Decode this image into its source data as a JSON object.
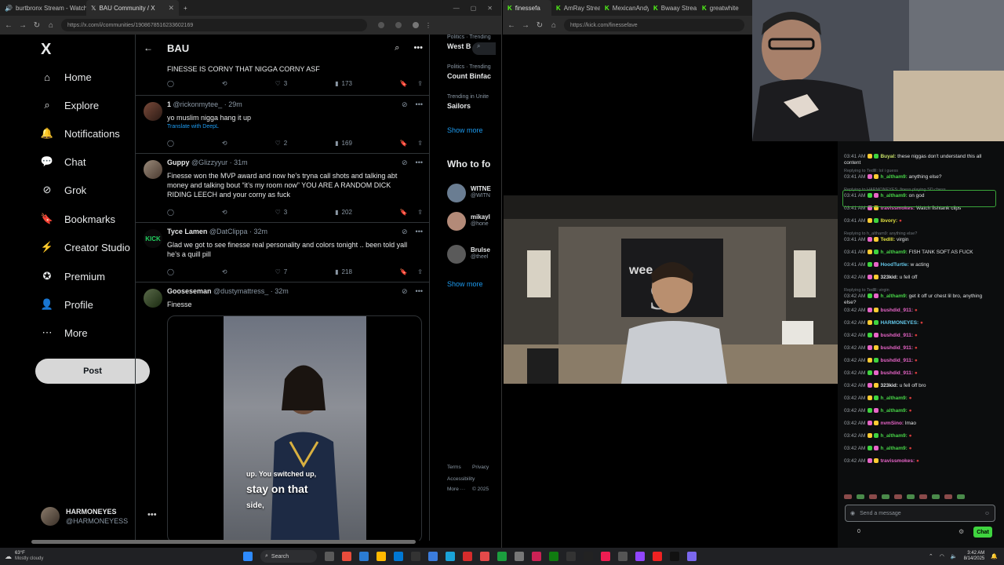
{
  "left_browser": {
    "tabs": [
      {
        "label": "burtbronx Stream - Watch Liv",
        "active": false
      },
      {
        "label": "BAU Community / X",
        "active": true
      }
    ],
    "new_tab": "+",
    "url": "https://x.com/i/communities/1908678516233602169"
  },
  "x_sidebar": {
    "logo": "X",
    "items": [
      {
        "label": "Home",
        "icon": "home-icon",
        "glyph": "⌂"
      },
      {
        "label": "Explore",
        "icon": "search-icon",
        "glyph": "⌕"
      },
      {
        "label": "Notifications",
        "icon": "bell-icon",
        "glyph": "🔔"
      },
      {
        "label": "Chat",
        "icon": "chat-icon",
        "glyph": "💬"
      },
      {
        "label": "Grok",
        "icon": "grok-icon",
        "glyph": "⊘"
      },
      {
        "label": "Bookmarks",
        "icon": "bookmark-icon",
        "glyph": "🔖"
      },
      {
        "label": "Creator Studio",
        "icon": "creator-studio-icon",
        "glyph": "⚡"
      },
      {
        "label": "Premium",
        "icon": "premium-icon",
        "glyph": "✪"
      },
      {
        "label": "Profile",
        "icon": "profile-icon",
        "glyph": "👤"
      },
      {
        "label": "More",
        "icon": "more-icon",
        "glyph": "⋯"
      }
    ],
    "post_label": "Post",
    "account_name": "HARMONEYES",
    "account_handle": "@HARMONEYESS"
  },
  "feed": {
    "title": "BAU",
    "prev_text": "FINESSE IS CORNY THAT NIGGA CORNY ASF",
    "prev_stats": {
      "likes": "3",
      "views": "173"
    },
    "tweets": [
      {
        "name": "1",
        "handle": "@rickonmytee_",
        "time": "29m",
        "text": "yo muslim nigga hang it up",
        "translate": "Translate with DeepL",
        "replies": "",
        "likes": "2",
        "views": "169"
      },
      {
        "name": "Guppy",
        "handle": "@Glizzyyur",
        "time": "31m",
        "text": "Finesse won the MVP award and now he’s tryna call shots and talking abt money and talking bout “it’s my room now” YOU ARE A RANDOM DICK RIDING LEECH and your corny as fuck",
        "likes": "3",
        "views": "202"
      },
      {
        "name": "Tyce Lamen",
        "handle": "@DatClippa",
        "time": "32m",
        "text": "Glad we got to see finesse real personality and colors tonight .. been told yall he’s a quill pill",
        "likes": "7",
        "views": "218"
      },
      {
        "name": "Gooseseman",
        "handle": "@dustymattress_",
        "time": "32m",
        "text": "Finesse"
      }
    ],
    "video_caption_1": "up. You switched up,",
    "video_caption_2": "stay on that",
    "video_caption_3": "side,"
  },
  "x_right": {
    "trend_1_cat": "Politics · Trending",
    "trend_1": "West B",
    "trend_2_cat": "Politics · Trending",
    "trend_2": "Count Binfac",
    "trend_3_cat": "Trending in Unite",
    "trend_3": "Sailors",
    "show_more": "Show more",
    "who_to_follow": "Who to fo",
    "follow": [
      {
        "name": "WITNE",
        "handle": "@WITN"
      },
      {
        "name": "mikayl",
        "handle": "@hone"
      },
      {
        "name": "Brulse",
        "handle": "@theel"
      }
    ],
    "show_more_2": "Show more",
    "footer_1": "Terms",
    "footer_2": "Privacy",
    "footer_3": "Accessibility",
    "footer_4": "More ···",
    "footer_5": "© 2025"
  },
  "right_browser": {
    "tabs": [
      "finessefa",
      "AmRay Strea",
      "MexicanAndy",
      "Bwaay Strea",
      "greatwhite"
    ],
    "url": "https://kick.com/finessefave"
  },
  "chat": {
    "messages": [
      {
        "time": "",
        "user": "",
        "text": "",
        "kind": "spacer"
      },
      {
        "time": "03:41 AM",
        "user": "Buyal:",
        "text": "these niggas don't understand this all content",
        "color": "#c9e36a"
      },
      {
        "kind": "reply",
        "text": "Replying to Tedlll: lol i guess"
      },
      {
        "time": "03:41 AM",
        "user": "h_altham9:",
        "text": "anything else?",
        "color": "#47d447"
      },
      {
        "kind": "reply",
        "text": "Replying to HARMONEYES: finess playing SD chess"
      },
      {
        "time": "03:41 AM",
        "user": "h_altham9:",
        "text": "on god",
        "color": "#47d447"
      },
      {
        "time": "03:41 AM",
        "user": "travissmokes:",
        "text": "Watch fishtank clips",
        "color": "#e865c8"
      },
      {
        "time": "03:41 AM",
        "user": "lbvory:",
        "text": "",
        "color": "#e0e040"
      },
      {
        "kind": "reply",
        "text": "Replying to h_altham9: anything else?"
      },
      {
        "time": "03:41 AM",
        "user": "Tedlll:",
        "text": "virgin",
        "color": "#e0e040"
      },
      {
        "time": "03:41 AM",
        "user": "h_altham9:",
        "text": "FISH TANK SOFT AS FUCK",
        "color": "#47d447"
      },
      {
        "time": "03:41 AM",
        "user": "HoodTurtle:",
        "text": "w acting",
        "color": "#63c6e8"
      },
      {
        "time": "03:42 AM",
        "user": "323kid:",
        "text": "u fell off",
        "color": "#dfe1e3"
      },
      {
        "kind": "reply",
        "text": "Replying to Tedlll: virgin"
      },
      {
        "time": "03:42 AM",
        "user": "h_altham9:",
        "text": "get it off ur chest lil bro, anything else?",
        "color": "#47d447"
      },
      {
        "time": "03:42 AM",
        "user": "bushdid_911:",
        "text": "",
        "color": "#e865c8"
      },
      {
        "time": "03:42 AM",
        "user": "HARMONEYES:",
        "text": "",
        "color": "#63c6e8"
      },
      {
        "time": "03:42 AM",
        "user": "bushdid_911:",
        "text": "",
        "color": "#e865c8"
      },
      {
        "time": "03:42 AM",
        "user": "bushdid_911:",
        "text": "",
        "color": "#e865c8"
      },
      {
        "time": "03:42 AM",
        "user": "bushdid_911:",
        "text": "",
        "color": "#e865c8"
      },
      {
        "time": "03:42 AM",
        "user": "bushdid_911:",
        "text": "",
        "color": "#e865c8"
      },
      {
        "time": "03:42 AM",
        "user": "323kid:",
        "text": "u fell off bro",
        "color": "#dfe1e3"
      },
      {
        "time": "03:42 AM",
        "user": "h_altham9:",
        "text": "",
        "color": "#47d447"
      },
      {
        "time": "03:42 AM",
        "user": "h_altham9:",
        "text": "",
        "color": "#47d447"
      },
      {
        "time": "03:42 AM",
        "user": "nvmSino:",
        "text": "lmao",
        "color": "#e865c8"
      },
      {
        "time": "03:42 AM",
        "user": "h_altham9:",
        "text": "",
        "color": "#47d447"
      },
      {
        "time": "03:42 AM",
        "user": "h_altham9:",
        "text": "",
        "color": "#47d447"
      },
      {
        "time": "03:42 AM",
        "user": "travissmokes:",
        "text": "",
        "color": "#e865c8"
      }
    ],
    "input_placeholder": "Send a message",
    "count": "0",
    "send_label": "Chat"
  },
  "taskbar": {
    "weather_temp": "63°F",
    "weather_desc": "Mostly cloudy",
    "search": "Search",
    "time": "3:42 AM",
    "date": "8/14/2025"
  }
}
